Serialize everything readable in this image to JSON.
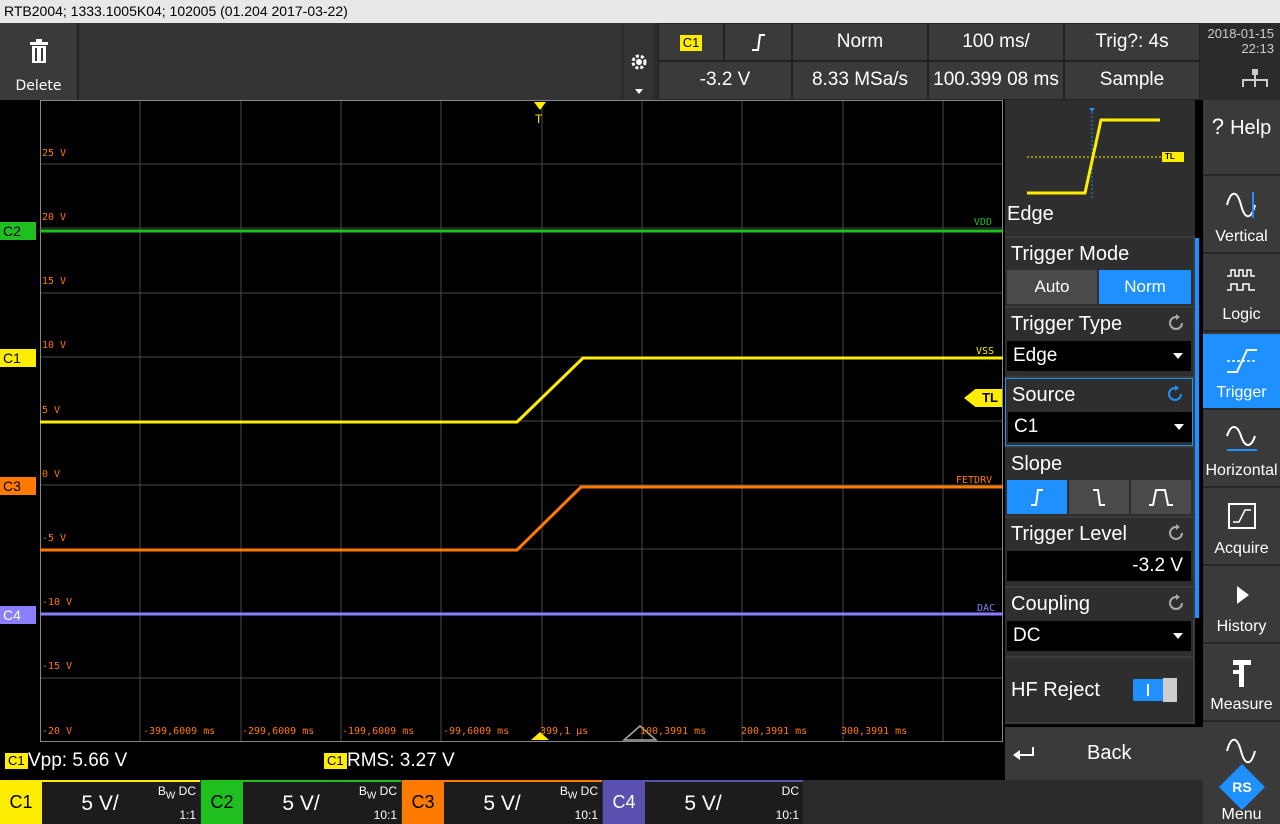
{
  "title_bar": "RTB2004; 1333.1005K04; 102005 (01.204 2017-03-22)",
  "toolbar": {
    "delete_label": "Delete",
    "channel_badge": "C1",
    "trigger_mode": "Norm",
    "timebase": "100 ms/",
    "trig_status": "Trig?: 4s",
    "trigger_level": "-3.2 V",
    "sample_rate": "8.33 MSa/s",
    "time_offset": "100.399 08 ms",
    "acq_mode": "Sample",
    "date": "2018-01-15",
    "time": "22:13"
  },
  "waveform": {
    "volt_labels": [
      "25 V",
      "20 V",
      "15 V",
      "10 V",
      "5 V",
      "0 V",
      "-5 V",
      "-10 V",
      "-15 V",
      "-20 V"
    ],
    "time_labels": [
      "-399,6009 ms",
      "-299,6009 ms",
      "-199,6009 ms",
      "-99,6009 ms",
      "399,1 µs",
      "100,3991 ms",
      "200,3991 ms",
      "300,3991 ms"
    ],
    "trace_names": {
      "c2": "VDD",
      "c1": "VSS",
      "c3": "FETDRV",
      "c4": "DAC"
    },
    "channel_tags": {
      "c1": "C1",
      "c2": "C2",
      "c3": "C3",
      "c4": "C4"
    },
    "tl_marker": "TL",
    "trigger_marker": "T"
  },
  "panel": {
    "diagram_label": "Edge",
    "diagram_tl": "TL",
    "trigger_mode_title": "Trigger Mode",
    "mode_auto": "Auto",
    "mode_norm": "Norm",
    "trigger_type_title": "Trigger Type",
    "trigger_type_value": "Edge",
    "source_title": "Source",
    "source_value": "C1",
    "slope_title": "Slope",
    "trigger_level_title": "Trigger Level",
    "trigger_level_value": "-3.2 V",
    "coupling_title": "Coupling",
    "coupling_value": "DC",
    "hf_reject_title": "HF Reject",
    "hf_reject_on": true
  },
  "sidebar": {
    "help": "Help",
    "vertical": "Vertical",
    "logic": "Logic",
    "trigger": "Trigger",
    "horizontal": "Horizontal",
    "acquire": "Acquire",
    "history": "History",
    "measure": "Measure",
    "menu": "Menu"
  },
  "measurements": {
    "m1_badge": "C1",
    "m1_text": "Vpp: 5.66 V",
    "m2_badge": "C1",
    "m2_text": "RMS: 3.27 V",
    "back": "Back"
  },
  "channels": [
    {
      "name": "C1",
      "scale": "5 V/",
      "bw": "DC",
      "ratio": "1:1",
      "color": "#ffed00"
    },
    {
      "name": "C2",
      "scale": "5 V/",
      "bw": "DC",
      "ratio": "10:1",
      "color": "#1fbf1f"
    },
    {
      "name": "C3",
      "scale": "5 V/",
      "bw": "DC",
      "ratio": "10:1",
      "color": "#ff7a00"
    },
    {
      "name": "C4",
      "scale": "5 V/",
      "bw": "DC",
      "ratio": "10:1",
      "color": "#6a5fd0"
    }
  ],
  "colors": {
    "c1": "#ffed00",
    "c2": "#1fbf1f",
    "c3": "#ff7a00",
    "c4": "#8a7fff",
    "accent": "#1e90ff"
  }
}
